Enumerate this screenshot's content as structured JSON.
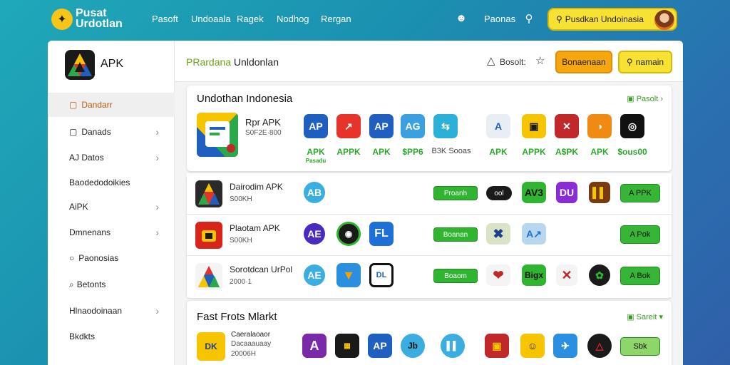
{
  "topbar": {
    "brand_line1": "Pusat",
    "brand_line2": "Urdotlan",
    "nav": [
      "Pasoft",
      "Undoaala",
      "Ragek",
      "Nodhog",
      "Rergan"
    ],
    "link": "Paonas",
    "profile_label": "Pusdkan Undoinasia"
  },
  "sidebar": {
    "title": "APK",
    "items": [
      {
        "label": "Dandarr",
        "icon": "▢",
        "chevron": false,
        "active": true
      },
      {
        "label": "Danads",
        "icon": "▢",
        "chevron": true,
        "active": false
      },
      {
        "label": "AJ Datos",
        "icon": "",
        "chevron": true,
        "active": false
      },
      {
        "label": "Baodedodoikies",
        "icon": "",
        "chevron": false,
        "active": false
      },
      {
        "label": "AiPK",
        "icon": "",
        "chevron": true,
        "active": false
      },
      {
        "label": "Dmnenans",
        "icon": "",
        "chevron": true,
        "active": false
      },
      {
        "label": "Paonosias",
        "icon": "○",
        "chevron": false,
        "active": false
      },
      {
        "label": "Betonts",
        "icon": "⌕",
        "chevron": false,
        "active": false
      },
      {
        "label": "Hlnaodoinaan",
        "icon": "",
        "chevron": true,
        "active": false
      },
      {
        "label": "Bkdkts",
        "icon": "",
        "chevron": false,
        "active": false
      }
    ]
  },
  "header": {
    "crumb_prefix": "P",
    "crumb_accent": "Rardana",
    "crumb_rest": " Unldonlan",
    "search_label": "Bosolt:",
    "btn_orange": "Bonaenaan",
    "btn_yellow": "namain"
  },
  "featured": {
    "title": "Undothan Indonesia",
    "see_all": "▣ Pasolt ›",
    "app_name": "Rpr APK",
    "app_size": "S0F2E·800",
    "icons": [
      {
        "text": "AP",
        "bg": "#1f5fbf",
        "label": "APK",
        "sub": "Pasadu"
      },
      {
        "text": "↗",
        "bg": "#e8332a",
        "label": "APPK",
        "sub": ""
      },
      {
        "text": "AP",
        "bg": "#1f5fbf",
        "label": "APK",
        "sub": ""
      },
      {
        "text": "AG",
        "bg": "#3aa0e0",
        "label": "$PP6",
        "sub": ""
      },
      {
        "text": "⇆",
        "bg": "#2bb0d8",
        "label": "B3K Sooas",
        "sub": ""
      },
      {
        "text": "A",
        "bg": "#e9eef5",
        "label": "APK",
        "sub": ""
      },
      {
        "text": "▣",
        "bg": "#f7c400",
        "label": "APPK",
        "sub": ""
      },
      {
        "text": "✕",
        "bg": "#c0282a",
        "label": "A$PK",
        "sub": ""
      },
      {
        "text": "◑",
        "bg": "#f08a12",
        "label": "APK",
        "sub": ""
      },
      {
        "text": "◎",
        "bg": "#111111",
        "label": "$ous00",
        "sub": ""
      }
    ]
  },
  "rows": [
    {
      "name": "Dairodim APK",
      "size": "S00KH",
      "icon_bg": "#2a2a2a",
      "btn_green": "Proanh",
      "pill": "ool",
      "extra": [
        "AV3",
        "DU",
        "▌▌"
      ],
      "download": "A PPK"
    },
    {
      "name": "Plaotam APK",
      "size": "S00KH",
      "icon_bg": "#d8241a",
      "btn_green": "Boanan",
      "pill": "",
      "extra": [
        "✖",
        "A↗",
        ""
      ],
      "download": "A Pok"
    },
    {
      "name": "Sorotdcan UrPol",
      "size": "2000·1",
      "icon_bg": "#1f5fbf",
      "btn_green": "Boaom",
      "pill": "",
      "extra": [
        "❤",
        "Bigx",
        "✕"
      ],
      "download": "A Bok"
    }
  ],
  "fast": {
    "title": "Fast Frots Mlarkt",
    "see_all": "▣ Sareit ▾",
    "app_name": "Caeralaoaor",
    "app_sub": "Dacaaauaay",
    "app_size": "20006H",
    "download": "Sbk"
  },
  "colors": {
    "accent_green": "#2fb52f",
    "accent_yellow": "#f7e233",
    "accent_orange": "#f6a70e"
  }
}
